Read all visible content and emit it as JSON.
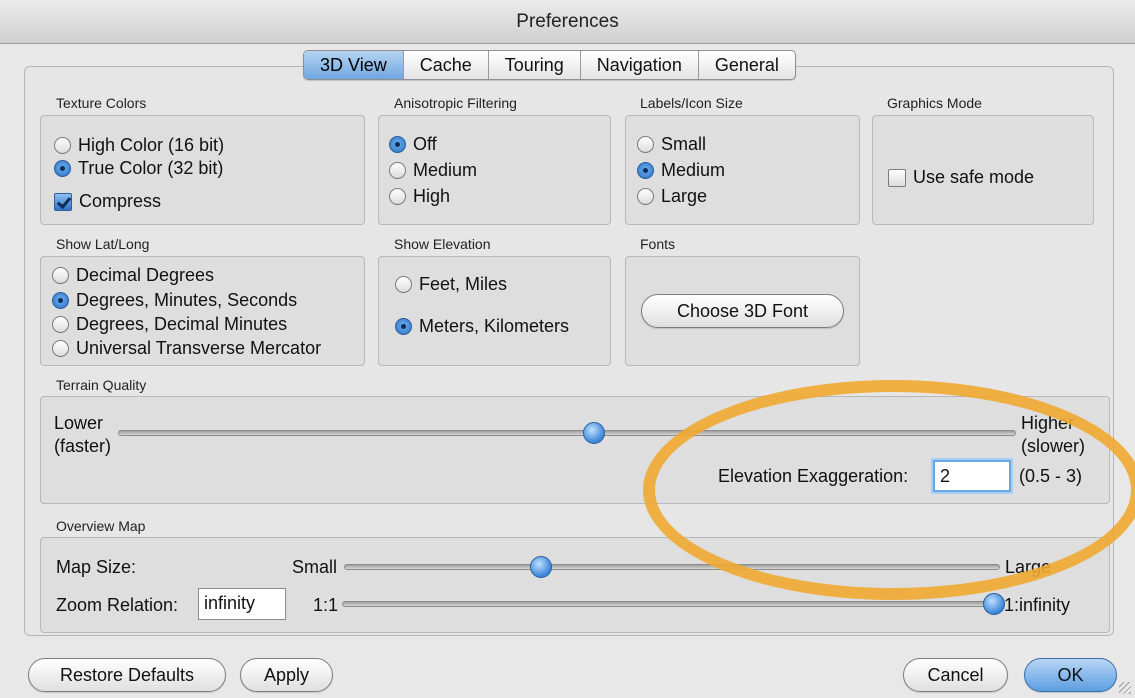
{
  "window": {
    "title": "Preferences"
  },
  "tabs": [
    {
      "label": "3D View",
      "active": true
    },
    {
      "label": "Cache",
      "active": false
    },
    {
      "label": "Touring",
      "active": false
    },
    {
      "label": "Navigation",
      "active": false
    },
    {
      "label": "General",
      "active": false
    }
  ],
  "texture_colors": {
    "title": "Texture Colors",
    "options": [
      "High Color (16 bit)",
      "True Color (32 bit)"
    ],
    "selected": "True Color (32 bit)",
    "compress_label": "Compress",
    "compress_checked": true
  },
  "anisotropic": {
    "title": "Anisotropic Filtering",
    "options": [
      "Off",
      "Medium",
      "High"
    ],
    "selected": "Off"
  },
  "labels_icon_size": {
    "title": "Labels/Icon Size",
    "options": [
      "Small",
      "Medium",
      "Large"
    ],
    "selected": "Medium"
  },
  "graphics_mode": {
    "title": "Graphics Mode",
    "safe_mode_label": "Use safe mode",
    "safe_mode_checked": false
  },
  "lat_long": {
    "title": "Show Lat/Long",
    "options": [
      "Decimal Degrees",
      "Degrees, Minutes, Seconds",
      "Degrees, Decimal Minutes",
      "Universal Transverse Mercator"
    ],
    "selected": "Degrees, Minutes, Seconds"
  },
  "elevation": {
    "title": "Show Elevation",
    "options": [
      "Feet, Miles",
      "Meters, Kilometers"
    ],
    "selected": "Meters, Kilometers"
  },
  "fonts": {
    "title": "Fonts",
    "button_label": "Choose 3D Font"
  },
  "terrain": {
    "title": "Terrain Quality",
    "lower_label": "Lower",
    "lower_sub": "(faster)",
    "higher_label": "Higher",
    "higher_sub": "(slower)",
    "quality_fraction": 0.53,
    "exaggeration_label": "Elevation Exaggeration:",
    "exaggeration_value": "2",
    "exaggeration_range": "(0.5 - 3)"
  },
  "overview_map": {
    "title": "Overview Map",
    "map_size_label": "Map Size:",
    "small_label": "Small",
    "large_label": "Large",
    "map_size_fraction": 0.3,
    "zoom_label": "Zoom Relation:",
    "zoom_value": "infinity",
    "zoom_min_label": "1:1",
    "zoom_max_label": "1:infinity",
    "zoom_fraction": 1.0
  },
  "buttons": {
    "restore": "Restore Defaults",
    "apply": "Apply",
    "cancel": "Cancel",
    "ok": "OK"
  },
  "colors": {
    "accent": "#4a90e2",
    "highlight": "#f0a830"
  }
}
